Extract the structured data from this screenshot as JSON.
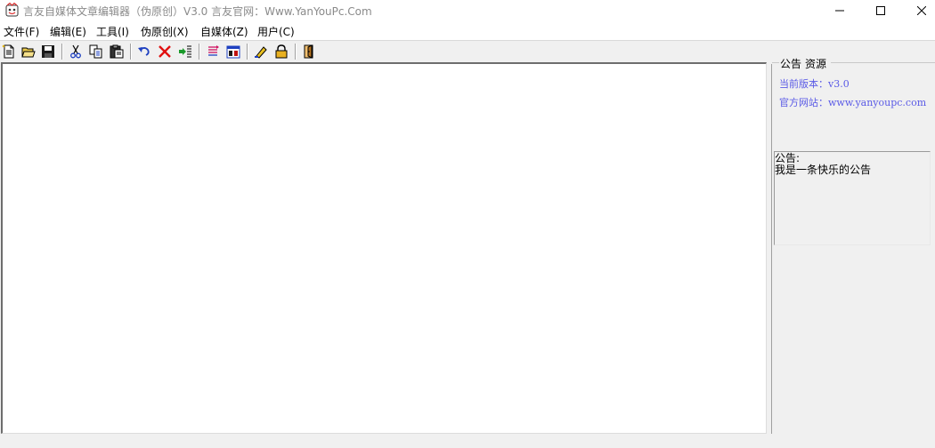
{
  "window": {
    "title": "言友自媒体文章编辑器（伪原创）V3.0 言友官网：Www.YanYouPc.Com",
    "controls": [
      "minimize",
      "maximize",
      "close"
    ]
  },
  "menu": {
    "items": [
      {
        "label": "文件(F)"
      },
      {
        "label": "编辑(E)"
      },
      {
        "label": "工具(I)"
      },
      {
        "label": "伪原创(X)"
      },
      {
        "label": "自媒体(Z)"
      },
      {
        "label": "用户(C)"
      }
    ]
  },
  "toolbar": {
    "buttons": [
      "new-file-icon",
      "open-folder-icon",
      "save-icon",
      "cut-icon",
      "copy-icon",
      "paste-icon",
      "undo-icon",
      "delete-icon",
      "insert-icon",
      "list-icon",
      "calendar-icon",
      "edit-icon",
      "lock-icon",
      "exit-icon"
    ]
  },
  "sidepanel": {
    "tabs": [
      {
        "label": "公告"
      },
      {
        "label": "资源"
      }
    ],
    "version_label": "当前版本：v3.0",
    "site_label": "官方网站：www.yanyoupc.com",
    "link_color": "#5a5ae6"
  },
  "notice": {
    "title": "公告:",
    "body": "我是一条快乐的公告"
  },
  "editor": {
    "content": ""
  }
}
